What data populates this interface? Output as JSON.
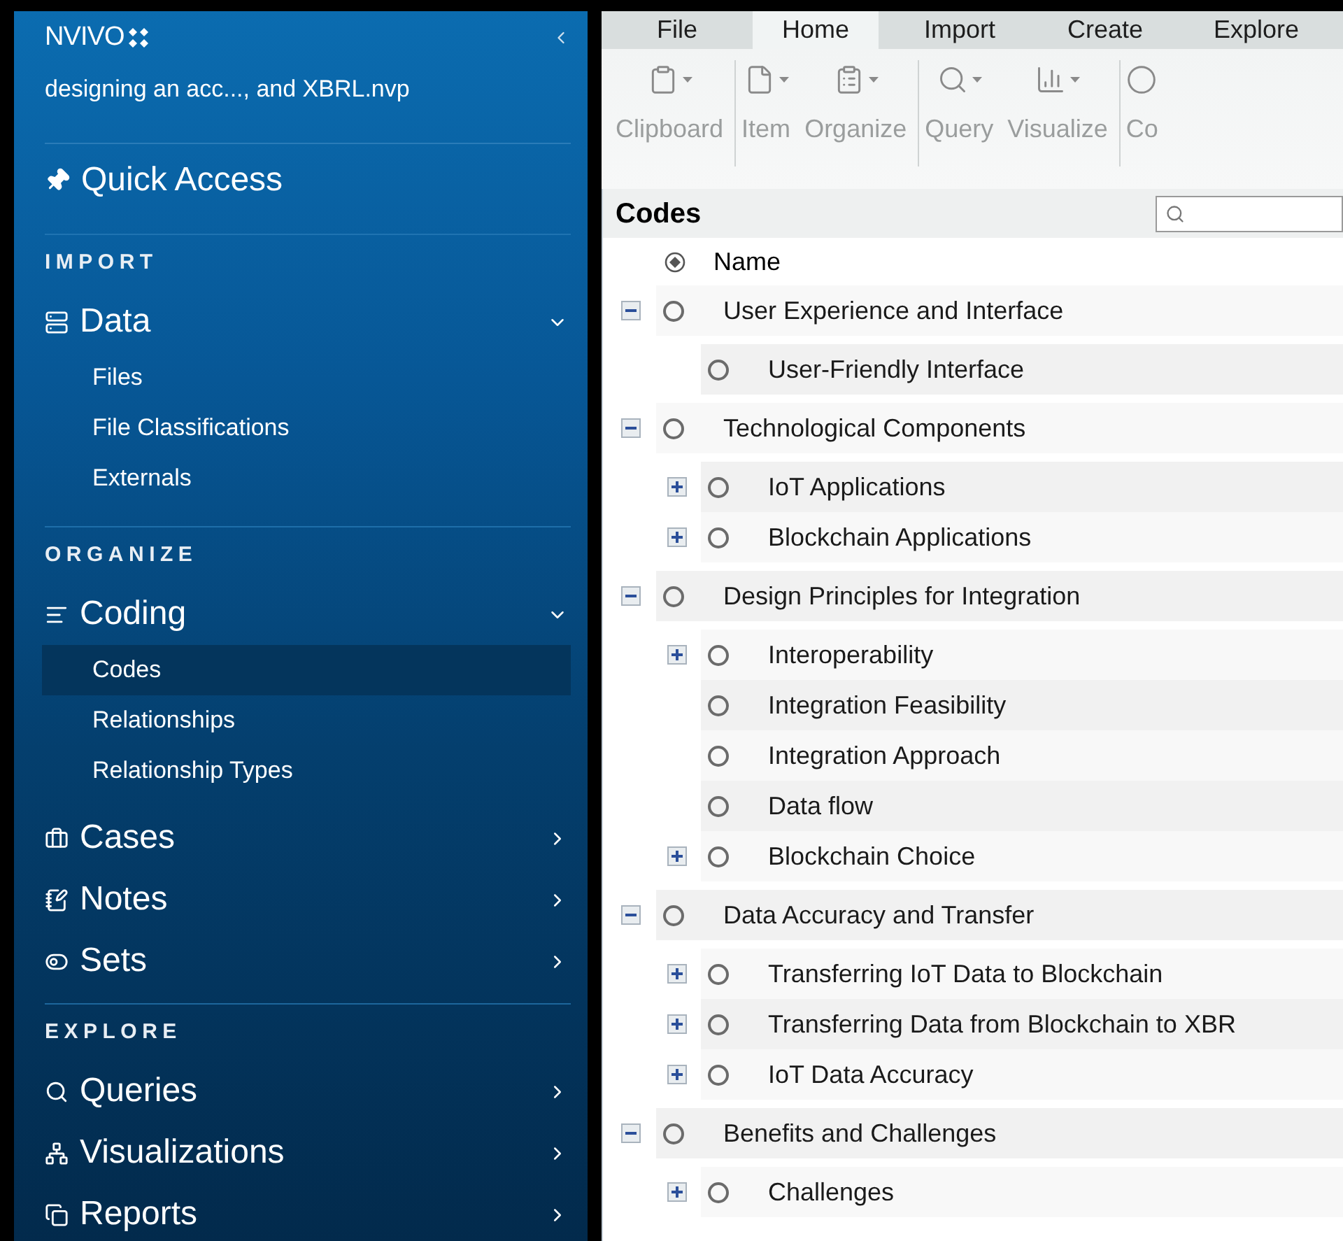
{
  "sidebar": {
    "logo": "NVIVO",
    "project": "designing an acc..., and XBRL.nvp",
    "quick_access": "Quick Access",
    "sections": [
      {
        "title": "IMPORT",
        "items": [
          {
            "label": "Data",
            "expanded": true,
            "children": [
              {
                "label": "Files",
                "selected": false
              },
              {
                "label": "File Classifications",
                "selected": false
              },
              {
                "label": "Externals",
                "selected": false
              }
            ]
          }
        ]
      },
      {
        "title": "ORGANIZE",
        "items": [
          {
            "label": "Coding",
            "expanded": true,
            "children": [
              {
                "label": "Codes",
                "selected": true
              },
              {
                "label": "Relationships",
                "selected": false
              },
              {
                "label": "Relationship Types",
                "selected": false
              }
            ]
          },
          {
            "label": "Cases",
            "expanded": false
          },
          {
            "label": "Notes",
            "expanded": false
          },
          {
            "label": "Sets",
            "expanded": false
          }
        ]
      },
      {
        "title": "EXPLORE",
        "items": [
          {
            "label": "Queries",
            "expanded": false
          },
          {
            "label": "Visualizations",
            "expanded": false
          },
          {
            "label": "Reports",
            "expanded": false
          }
        ]
      }
    ]
  },
  "ribbon": {
    "tabs": [
      {
        "label": "File",
        "selected": false
      },
      {
        "label": "Home",
        "selected": true
      },
      {
        "label": "Import",
        "selected": false
      },
      {
        "label": "Create",
        "selected": false
      },
      {
        "label": "Explore",
        "selected": false
      }
    ],
    "groups": [
      {
        "items": [
          "Clipboard"
        ]
      },
      {
        "items": [
          "Item",
          "Organize"
        ]
      },
      {
        "items": [
          "Query",
          "Visualize"
        ]
      },
      {
        "items": [
          "Co"
        ]
      }
    ]
  },
  "codes": {
    "title": "Codes",
    "column": "Name",
    "nodes": [
      {
        "name": "User Experience and Interface",
        "expanded": true,
        "children": [
          {
            "name": "User-Friendly Interface"
          }
        ]
      },
      {
        "name": "Technological Components",
        "expanded": true,
        "children": [
          {
            "name": "IoT Applications",
            "expanded": false
          },
          {
            "name": "Blockchain Applications",
            "expanded": false
          }
        ]
      },
      {
        "name": "Design Principles for Integration",
        "expanded": true,
        "children": [
          {
            "name": "Interoperability",
            "expanded": false
          },
          {
            "name": "Integration Feasibility"
          },
          {
            "name": "Integration Approach"
          },
          {
            "name": "Data flow"
          },
          {
            "name": "Blockchain Choice",
            "expanded": false
          }
        ]
      },
      {
        "name": "Data Accuracy and Transfer",
        "expanded": true,
        "children": [
          {
            "name": "Transferring IoT Data to Blockchain",
            "expanded": false
          },
          {
            "name": "Transferring Data from Blockchain to XBR",
            "expanded": false
          },
          {
            "name": "IoT Data Accuracy",
            "expanded": false
          }
        ]
      },
      {
        "name": "Benefits and Challenges",
        "expanded": true,
        "children": [
          {
            "name": "Challenges",
            "expanded": false
          }
        ]
      }
    ]
  }
}
